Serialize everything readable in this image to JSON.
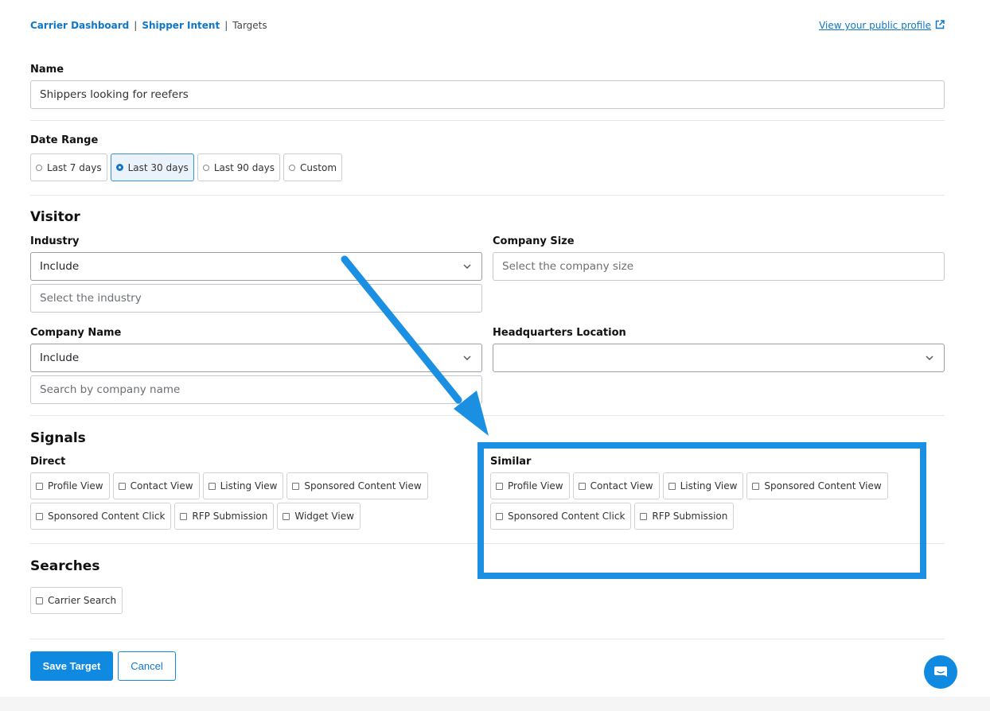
{
  "breadcrumb": {
    "items": [
      "Carrier Dashboard",
      "Shipper Intent",
      "Targets"
    ],
    "separator": "|"
  },
  "public_profile_link": "View your public profile",
  "name": {
    "label": "Name",
    "value": "Shippers looking for reefers"
  },
  "date_range": {
    "label": "Date Range",
    "options": [
      "Last 7 days",
      "Last 30 days",
      "Last 90 days",
      "Custom"
    ],
    "selected": "Last 30 days"
  },
  "visitor": {
    "title": "Visitor",
    "industry": {
      "label": "Industry",
      "mode": "Include",
      "placeholder": "Select the industry"
    },
    "company_size": {
      "label": "Company Size",
      "placeholder": "Select the company size"
    },
    "company_name": {
      "label": "Company Name",
      "mode": "Include",
      "placeholder": "Search by company name"
    },
    "hq_location": {
      "label": "Headquarters Location",
      "value": ""
    }
  },
  "signals": {
    "title": "Signals",
    "direct": {
      "label": "Direct",
      "options": [
        "Profile View",
        "Contact View",
        "Listing View",
        "Sponsored Content View",
        "Sponsored Content Click",
        "RFP Submission",
        "Widget View"
      ]
    },
    "similar": {
      "label": "Similar",
      "options": [
        "Profile View",
        "Contact View",
        "Listing View",
        "Sponsored Content View",
        "Sponsored Content Click",
        "RFP Submission"
      ]
    }
  },
  "searches": {
    "title": "Searches",
    "options": [
      "Carrier Search"
    ]
  },
  "actions": {
    "save": "Save Target",
    "cancel": "Cancel"
  },
  "colors": {
    "accent": "#0f8ae0",
    "link": "#0f77c7",
    "annotation": "#1b8fe1"
  },
  "icons": [
    "external-link-icon",
    "chevron-down-icon",
    "chat-icon",
    "annotation-arrow-icon"
  ]
}
